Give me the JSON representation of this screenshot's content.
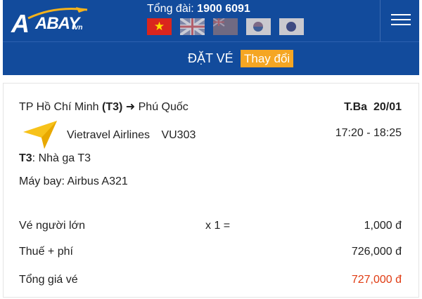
{
  "header": {
    "logo_text": "ABAY",
    "logo_suffix": ".vn",
    "hotline_label": "Tổng đài:",
    "hotline_number": "1900 6091",
    "languages": [
      {
        "name": "vietnam-flag"
      },
      {
        "name": "uk-flag"
      },
      {
        "name": "australia-flag"
      },
      {
        "name": "korea-flag"
      },
      {
        "name": "japan-flag"
      }
    ],
    "brand_color": "#124b9c"
  },
  "subbar": {
    "title": "ĐẶT VÉ",
    "change_label": "Thay đổi",
    "change_color": "#f5a623"
  },
  "flight": {
    "from": "TP Hồ Chí Minh",
    "from_code": "(T3)",
    "to": "Phú Quốc",
    "day": "T.Ba",
    "date": "20/01",
    "airline": "Vietravel Airlines",
    "flight_number": "VU303",
    "time": "17:20 - 18:25",
    "terminal_code": "T3",
    "terminal_text": ": Nhà ga T3",
    "aircraft": "Máy bay: Airbus A321"
  },
  "pricing": {
    "adult_label": "Vé người lớn",
    "adult_qty": "x 1 =",
    "adult_price": "1,000 đ",
    "tax_label": "Thuế + phí",
    "tax_price": "726,000 đ",
    "total_label": "Tổng giá vé",
    "total_price": "727,000 đ",
    "total_color": "#e03b12"
  }
}
